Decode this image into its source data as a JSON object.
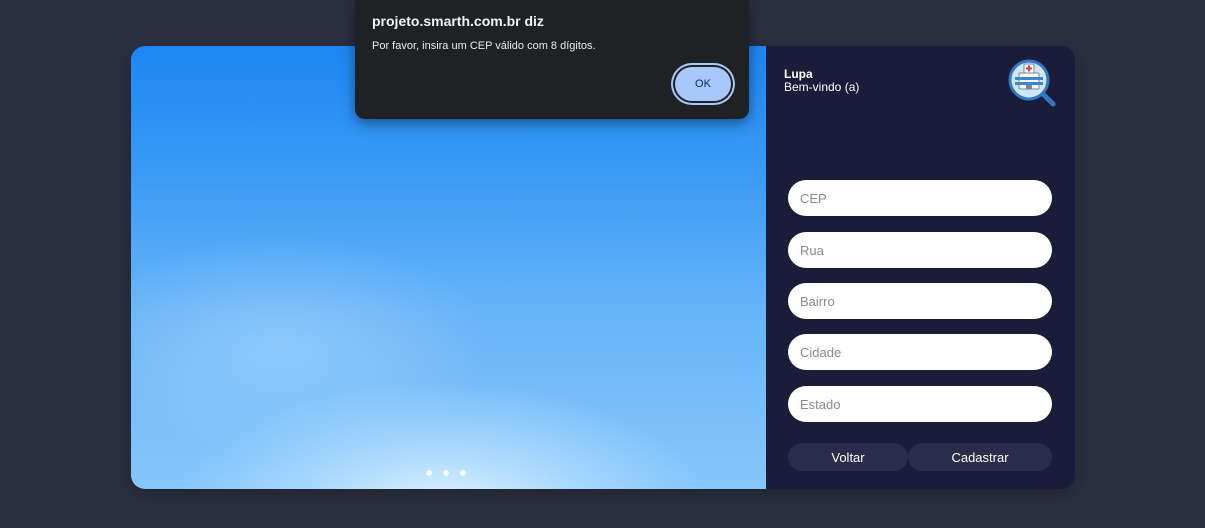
{
  "dialog": {
    "title": "projeto.smarth.com.br diz",
    "message": "Por favor, insira um CEP válido com 8 dígitos.",
    "ok_label": "OK"
  },
  "brand": {
    "name": "Lupa",
    "welcome": "Bem-vindo (a)",
    "logo_icon": "hospital-magnifier-icon"
  },
  "form": {
    "cep_placeholder": "CEP",
    "rua_placeholder": "Rua",
    "bairro_placeholder": "Bairro",
    "cidade_placeholder": "Cidade",
    "estado_placeholder": "Estado",
    "back_label": "Voltar",
    "submit_label": "Cadastrar"
  },
  "carousel": {
    "dot_count": 3
  },
  "colors": {
    "page_background": "#2c2f40",
    "panel_background": "#1b1c3a",
    "dialog_background": "#202124",
    "ok_button": "#a8c7fa",
    "sky_blue": "#1d86f2"
  }
}
